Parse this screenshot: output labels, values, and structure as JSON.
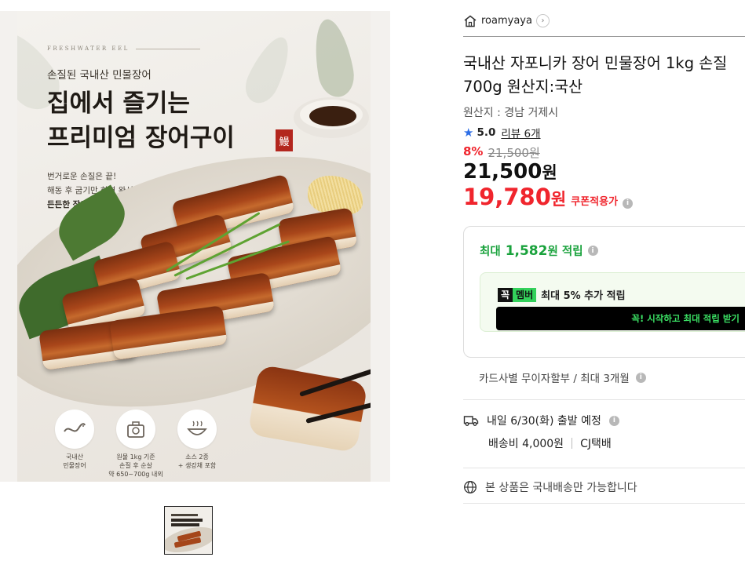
{
  "image": {
    "brand_en": "FRESHWATER EEL",
    "subheading": "손질된 국내산 민물장어",
    "headline_line1": "집에서 즐기는",
    "headline_line2": "프리미엄 장어구이",
    "seal_char": "鰻",
    "copy_line1": "번거로운 손질은 끝!",
    "copy_line2": "해동 후 굽기만 하면 완성되는",
    "copy_line3": "든든한 장어 한 상",
    "badges": [
      {
        "icon": "eel-icon",
        "line1": "국내산",
        "line2": "민물장어",
        "line3": ""
      },
      {
        "icon": "scale-icon",
        "line1": "원물 1kg 기준",
        "line2": "손질 후 순살",
        "line3": "약 650~700g 내외"
      },
      {
        "icon": "bowl-icon",
        "line1": "소스 2종",
        "line2": "+ 생강채 포함",
        "line3": ""
      }
    ]
  },
  "seller": {
    "name": "roamyaya",
    "icon": "store-icon"
  },
  "product": {
    "title_line1": "국내산 자포니카 장어 민물장어 1kg 손질",
    "title_line2": "700g 원산지:국산",
    "origin": "원산지 : 경남 거제시",
    "rating": "5.0",
    "review_label": "리뷰 6개",
    "discount": "8%",
    "original_price": "21,500원",
    "price_number": "21,500",
    "price_unit": "원",
    "coupon_price_number": "19,780",
    "coupon_price_unit": "원",
    "coupon_label": "쿠폰적용가"
  },
  "reward": {
    "prefix": "최대",
    "amount": "1,582",
    "suffix": "원 적립",
    "member_badge_dark": "꼭",
    "member_badge_green": "멤버",
    "member_text": "최대 5% 추가 적립",
    "member_button": "꼭! 시작하고 최대 적립 받기",
    "member_button_chevron": "›"
  },
  "payment": {
    "card_text": "카드사별 무이자할부 / 최대 3개월"
  },
  "shipping": {
    "departure": "내일 6/30(화) 출발 예정",
    "fee": "배송비 4,000원",
    "carrier": "CJ택배",
    "domestic_notice": "본 상품은 국내배송만 가능합니다"
  },
  "colors": {
    "discount_red": "#f0252d",
    "reward_green": "#19a23c",
    "star_blue": "#2d6ee6",
    "member_green": "#33d15b"
  }
}
